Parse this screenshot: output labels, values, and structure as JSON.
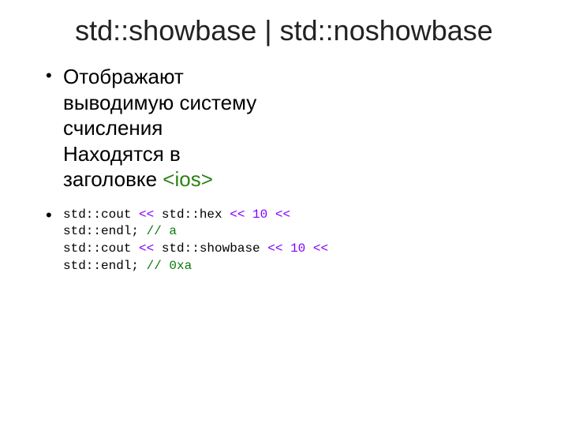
{
  "title": "std::showbase | std::noshowbase",
  "bullet1": {
    "line1": "Отображают",
    "line2": "выводимую систему",
    "line3": "счисления",
    "line4": "Находятся в",
    "line5_prefix": "заголовке ",
    "line5_tag": "<ios>"
  },
  "code": {
    "l1": {
      "s1": "std::cout ",
      "op1": "<<",
      "s2": " std::hex ",
      "op2": "<<",
      "s3": " ",
      "num": "10",
      "s4": " ",
      "op3": "<<"
    },
    "l2": {
      "s1": "std::endl; ",
      "comment": "// a"
    },
    "l3": {
      "s1": "std::cout ",
      "op1": "<<",
      "s2": " std::showbase ",
      "op2": "<<",
      "s3": " ",
      "num": "10",
      "s4": " ",
      "op3": "<<"
    },
    "l4": {
      "s1": "std::endl; ",
      "comment": "// 0xa"
    }
  }
}
